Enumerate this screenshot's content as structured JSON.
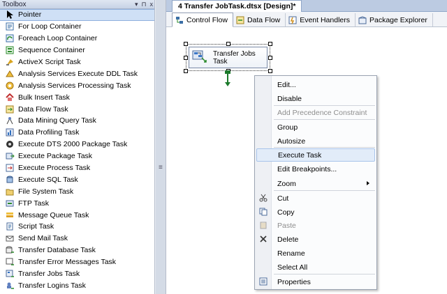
{
  "toolbox": {
    "title": "Toolbox",
    "header_buttons": [
      "▾",
      "⊓",
      "x"
    ],
    "items": [
      {
        "label": "Pointer",
        "icon": "pointer-arrow-icon",
        "selected": true
      },
      {
        "label": "For Loop Container",
        "icon": "for-loop-icon"
      },
      {
        "label": "Foreach Loop Container",
        "icon": "foreach-loop-icon"
      },
      {
        "label": "Sequence Container",
        "icon": "sequence-container-icon"
      },
      {
        "label": "ActiveX Script Task",
        "icon": "activex-script-icon"
      },
      {
        "label": "Analysis Services Execute DDL Task",
        "icon": "analysis-ddl-icon"
      },
      {
        "label": "Analysis Services Processing Task",
        "icon": "analysis-processing-icon"
      },
      {
        "label": "Bulk Insert Task",
        "icon": "bulk-insert-icon"
      },
      {
        "label": "Data Flow Task",
        "icon": "data-flow-icon"
      },
      {
        "label": "Data Mining Query Task",
        "icon": "data-mining-icon"
      },
      {
        "label": "Data Profiling Task",
        "icon": "data-profiling-icon"
      },
      {
        "label": "Execute DTS 2000 Package Task",
        "icon": "execute-dts-icon"
      },
      {
        "label": "Execute Package Task",
        "icon": "execute-package-icon"
      },
      {
        "label": "Execute Process Task",
        "icon": "execute-process-icon"
      },
      {
        "label": "Execute SQL Task",
        "icon": "execute-sql-icon"
      },
      {
        "label": "File System Task",
        "icon": "file-system-icon"
      },
      {
        "label": "FTP Task",
        "icon": "ftp-icon"
      },
      {
        "label": "Message Queue Task",
        "icon": "message-queue-icon"
      },
      {
        "label": "Script Task",
        "icon": "script-icon"
      },
      {
        "label": "Send Mail Task",
        "icon": "send-mail-icon"
      },
      {
        "label": "Transfer Database Task",
        "icon": "transfer-database-icon"
      },
      {
        "label": "Transfer Error Messages Task",
        "icon": "transfer-error-messages-icon"
      },
      {
        "label": "Transfer Jobs Task",
        "icon": "transfer-jobs-icon"
      },
      {
        "label": "Transfer Logins Task",
        "icon": "transfer-logins-icon"
      }
    ]
  },
  "splitter_grip": "≡",
  "document_tab": {
    "title": "4 Transfer JobTask.dtsx [Design]*"
  },
  "designer_tabs": [
    {
      "label": "Control Flow",
      "icon": "control-flow-icon",
      "active": true
    },
    {
      "label": "Data Flow",
      "icon": "data-flow-tab-icon"
    },
    {
      "label": "Event Handlers",
      "icon": "event-handlers-icon"
    },
    {
      "label": "Package Explorer",
      "icon": "package-explorer-icon"
    }
  ],
  "task": {
    "label_line1": "Transfer Jobs",
    "label_line2": "Task",
    "icon": "transfer-jobs-task-icon"
  },
  "context_menu": {
    "items": [
      {
        "label": "Edit...",
        "icon": ""
      },
      {
        "label": "Disable",
        "icon": ""
      },
      {
        "label": "Add Precedence Constraint",
        "icon": "",
        "disabled": true
      },
      {
        "label": "Group",
        "icon": ""
      },
      {
        "label": "Autosize",
        "icon": ""
      },
      {
        "label": "Execute Task",
        "icon": "",
        "highlighted": true
      },
      {
        "label": "Edit Breakpoints...",
        "icon": ""
      },
      {
        "label": "Zoom",
        "icon": "",
        "submenu": true
      },
      {
        "label": "Cut",
        "icon": "scissors-icon"
      },
      {
        "label": "Copy",
        "icon": "copy-icon"
      },
      {
        "label": "Paste",
        "icon": "paste-icon",
        "disabled": true
      },
      {
        "label": "Delete",
        "icon": "delete-x-icon"
      },
      {
        "label": "Rename",
        "icon": ""
      },
      {
        "label": "Select All",
        "icon": ""
      },
      {
        "label": "Properties",
        "icon": "properties-icon"
      }
    ]
  },
  "colors": {
    "accent_selection": "#cfe0f6",
    "menu_highlight": "#e2ecf9",
    "precedence_arrow": "#1b7a2a",
    "panel_header": "#c7d3e6"
  }
}
